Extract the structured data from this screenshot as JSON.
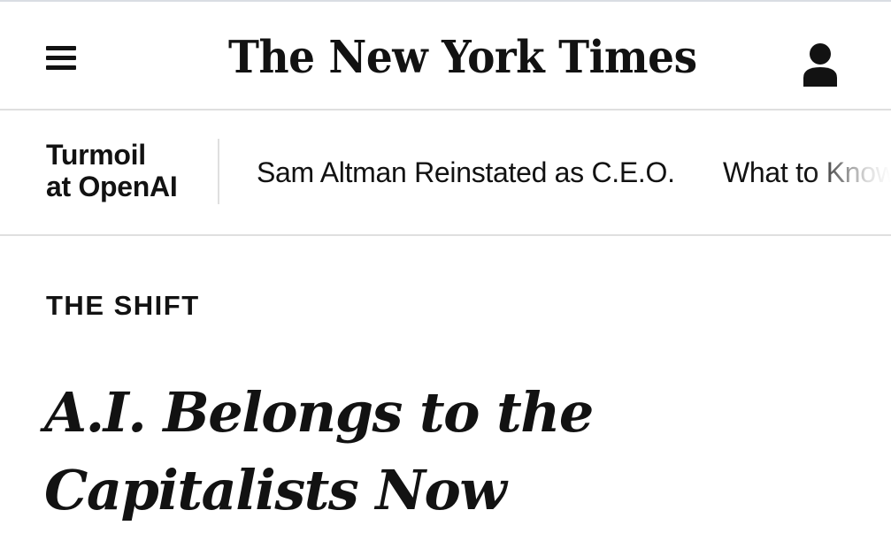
{
  "header": {
    "menu_icon": "hamburger-menu-icon",
    "logo_text": "The New York Times",
    "account_icon": "user-account-icon"
  },
  "subnav": {
    "section_title_line1": "Turmoil",
    "section_title_line2": "at OpenAI",
    "links": [
      {
        "label": "Sam Altman Reinstated as C.E.O."
      },
      {
        "label": "What to Know"
      }
    ]
  },
  "article": {
    "kicker": "THE SHIFT",
    "headline": "A.I. Belongs to the Capitalists Now"
  }
}
